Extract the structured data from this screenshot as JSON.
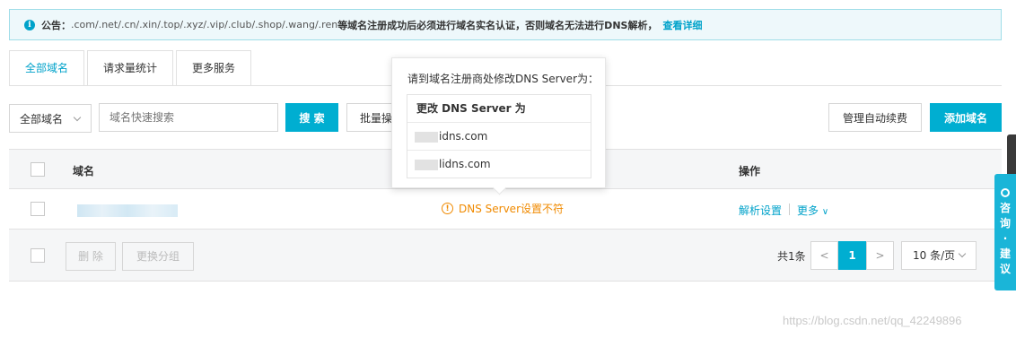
{
  "notice": {
    "label": "公告：",
    "text": ".com/.net/.cn/.xin/.top/.xyz/.vip/.club/.shop/.wang/.ren",
    "text_bold": "等域名注册成功后必须进行域名实名认证，否则域名无法进行DNS解析，",
    "link": "查看详细"
  },
  "tabs": [
    {
      "label": "全部域名",
      "active": true
    },
    {
      "label": "请求量统计",
      "active": false
    },
    {
      "label": "更多服务",
      "active": false
    }
  ],
  "toolbar": {
    "filter_value": "全部域名",
    "search_placeholder": "域名快速搜索",
    "search_label": "搜 索",
    "batch_label": "批量操作",
    "renew_label": "管理自动续费",
    "add_label": "添加域名"
  },
  "table": {
    "headers": {
      "domain": "域名",
      "action": "操作"
    },
    "rows": [
      {
        "status": "DNS Server设置不符",
        "actions": {
          "primary": "解析设置",
          "more": "更多"
        }
      }
    ]
  },
  "footer": {
    "delete_label": "删 除",
    "group_label": "更换分组",
    "total": "共1条",
    "current_page": "1",
    "prev": "<",
    "next": ">",
    "page_size": "10 条/页"
  },
  "popover": {
    "title": "请到域名注册商处修改DNS Server为：",
    "header": "更改 DNS Server 为",
    "servers": [
      "idns.com",
      "lidns.com"
    ]
  },
  "side_widget": {
    "chars": [
      "咨",
      "询",
      "·",
      "建",
      "议"
    ]
  },
  "watermark": "https://blog.csdn.net/qq_42249896",
  "colors": {
    "accent": "#00aed1",
    "warning": "#f08a00",
    "link": "#00a2ca"
  }
}
